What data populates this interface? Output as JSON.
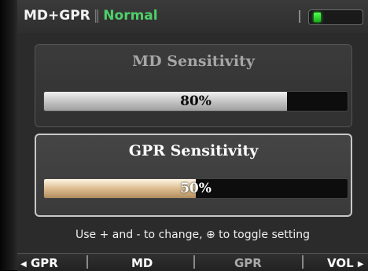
{
  "status_bar": {
    "mode_label": "MD+GPR",
    "separator": "‖",
    "state_label": "Normal",
    "state_color": "#4fd06a",
    "battery_icon": "battery-icon",
    "battery_level": 0.15
  },
  "md_sensitivity": {
    "title": "MD Sensitivity",
    "value_text": "80%",
    "value": 80,
    "fill_color": "#c9c9c9"
  },
  "gpr_sensitivity": {
    "title": "GPR Sensitivity",
    "value_text": "50%",
    "value": 50,
    "selected": true,
    "fill_color": "#dcbd90"
  },
  "help_text": "Use + and - to change, ⊕ to toggle setting",
  "softkeys": [
    {
      "label": "GPR",
      "color": "#ffffff",
      "arrow": "left"
    },
    {
      "label": "MD",
      "color": "#ffffff"
    },
    {
      "label": "GPR",
      "color": "#a9a9a9"
    },
    {
      "label": "VOL",
      "color": "#ffffff",
      "arrow": "right"
    }
  ]
}
